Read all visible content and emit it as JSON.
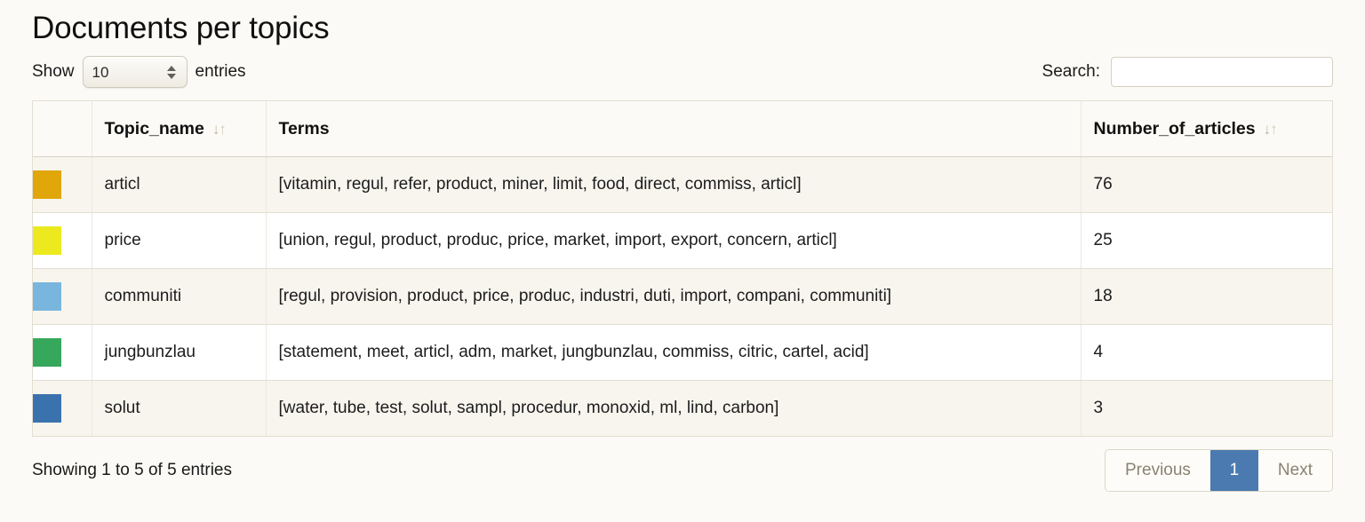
{
  "title": "Documents per topics",
  "controls": {
    "show_label_prefix": "Show",
    "show_label_suffix": "entries",
    "page_length_value": "10",
    "search_label": "Search:",
    "search_value": "",
    "search_placeholder": ""
  },
  "table": {
    "columns": [
      {
        "key": "swatch",
        "label": "",
        "sortable": false
      },
      {
        "key": "topic_name",
        "label": "Topic_name",
        "sortable": true
      },
      {
        "key": "terms",
        "label": "Terms",
        "sortable": false
      },
      {
        "key": "number_of_articles",
        "label": "Number_of_articles",
        "sortable": true
      }
    ],
    "rows": [
      {
        "color": "#e0a60a",
        "topic_name": "articl",
        "terms": "[vitamin, regul, refer, product, miner, limit, food, direct, commiss, articl]",
        "number_of_articles": "76"
      },
      {
        "color": "#ecea1f",
        "topic_name": "price",
        "terms": "[union, regul, product, produc, price, market, import, export, concern, articl]",
        "number_of_articles": "25"
      },
      {
        "color": "#79b6de",
        "topic_name": "communiti",
        "terms": "[regul, provision, product, price, produc, industri, duti, import, compani, communiti]",
        "number_of_articles": "18"
      },
      {
        "color": "#35a85b",
        "topic_name": "jungbunzlau",
        "terms": "[statement, meet, articl, adm, market, jungbunzlau, commiss, citric, cartel, acid]",
        "number_of_articles": "4"
      },
      {
        "color": "#3a72ad",
        "topic_name": "solut",
        "terms": "[water, tube, test, solut, sampl, procedur, monoxid, ml, lind, carbon]",
        "number_of_articles": "3"
      }
    ]
  },
  "footer": {
    "info": "Showing 1 to 5 of 5 entries",
    "previous_label": "Previous",
    "current_page": "1",
    "next_label": "Next"
  },
  "colors": {
    "page_background": "#fbfaf6",
    "row_odd": "#f7f5ee",
    "row_even": "#ffffff",
    "border": "#e3ded2",
    "active_page": "#4a7ab0"
  }
}
